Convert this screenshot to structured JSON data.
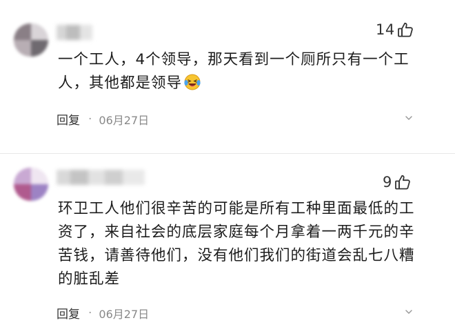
{
  "colors": {
    "text": "#1c1c1c",
    "meta": "#888888",
    "divider": "#e8e8e8"
  },
  "comments": [
    {
      "likes": "14",
      "text_lines": [
        "一个工人，4个领导，那天看到一个厕所只有一个工",
        "人，其他都是领导"
      ],
      "emoji": "laughing-tears-emoji",
      "reply_label": "回复",
      "separator": "·",
      "date": "06月27日"
    },
    {
      "likes": "9",
      "text_lines": [
        "环卫工人他们很辛苦的可能是所有工种里面最低的工",
        "资了，来自社会的底层家庭每个月拿着一两千元的辛",
        "苦钱，请善待他们，没有他们我们的街道会乱七八糟",
        "的脏乱差"
      ],
      "reply_label": "回复",
      "separator": "·",
      "date": "06月27日"
    }
  ]
}
